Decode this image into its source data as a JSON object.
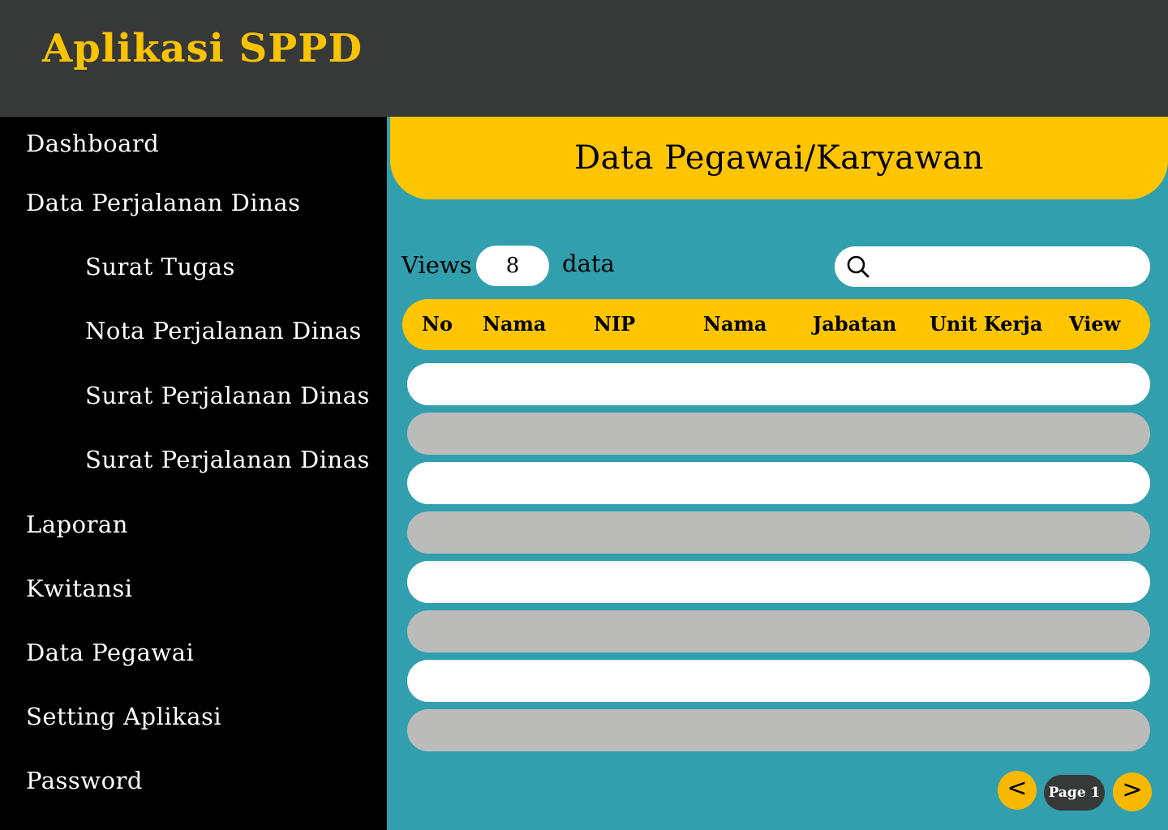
{
  "app": {
    "title": "Aplikasi SPPD"
  },
  "sidebar": {
    "items": [
      {
        "label": "Dashboard"
      },
      {
        "label": "Data Perjalanan Dinas"
      },
      {
        "label": "Surat Tugas"
      },
      {
        "label": "Nota Perjalanan Dinas"
      },
      {
        "label": "Surat Perjalanan Dinas"
      },
      {
        "label": "Surat Perjalanan Dinas"
      },
      {
        "label": "Laporan"
      },
      {
        "label": "Kwitansi"
      },
      {
        "label": "Data Pegawai"
      },
      {
        "label": "Setting Aplikasi"
      },
      {
        "label": "Password"
      }
    ]
  },
  "main": {
    "title": "Data Pegawai/Karyawan",
    "views_label": "Views",
    "views_value": "8",
    "data_label": "data",
    "search": {
      "placeholder": "",
      "icon": "search-icon"
    },
    "table": {
      "columns": [
        "No",
        "Nama",
        "NIP",
        "Nama",
        "Jabatan",
        "Unit Kerja",
        "View"
      ],
      "rows": [
        [],
        [],
        [],
        [],
        [],
        [],
        [],
        []
      ]
    },
    "pagination": {
      "prev": "<",
      "page_label": "Page 1",
      "next": ">"
    }
  },
  "colors": {
    "topbar": "#373838",
    "title": "#f8c300",
    "accent": "#fec500",
    "main_bg": "#319fad",
    "row_alt": "#bbbbba"
  }
}
